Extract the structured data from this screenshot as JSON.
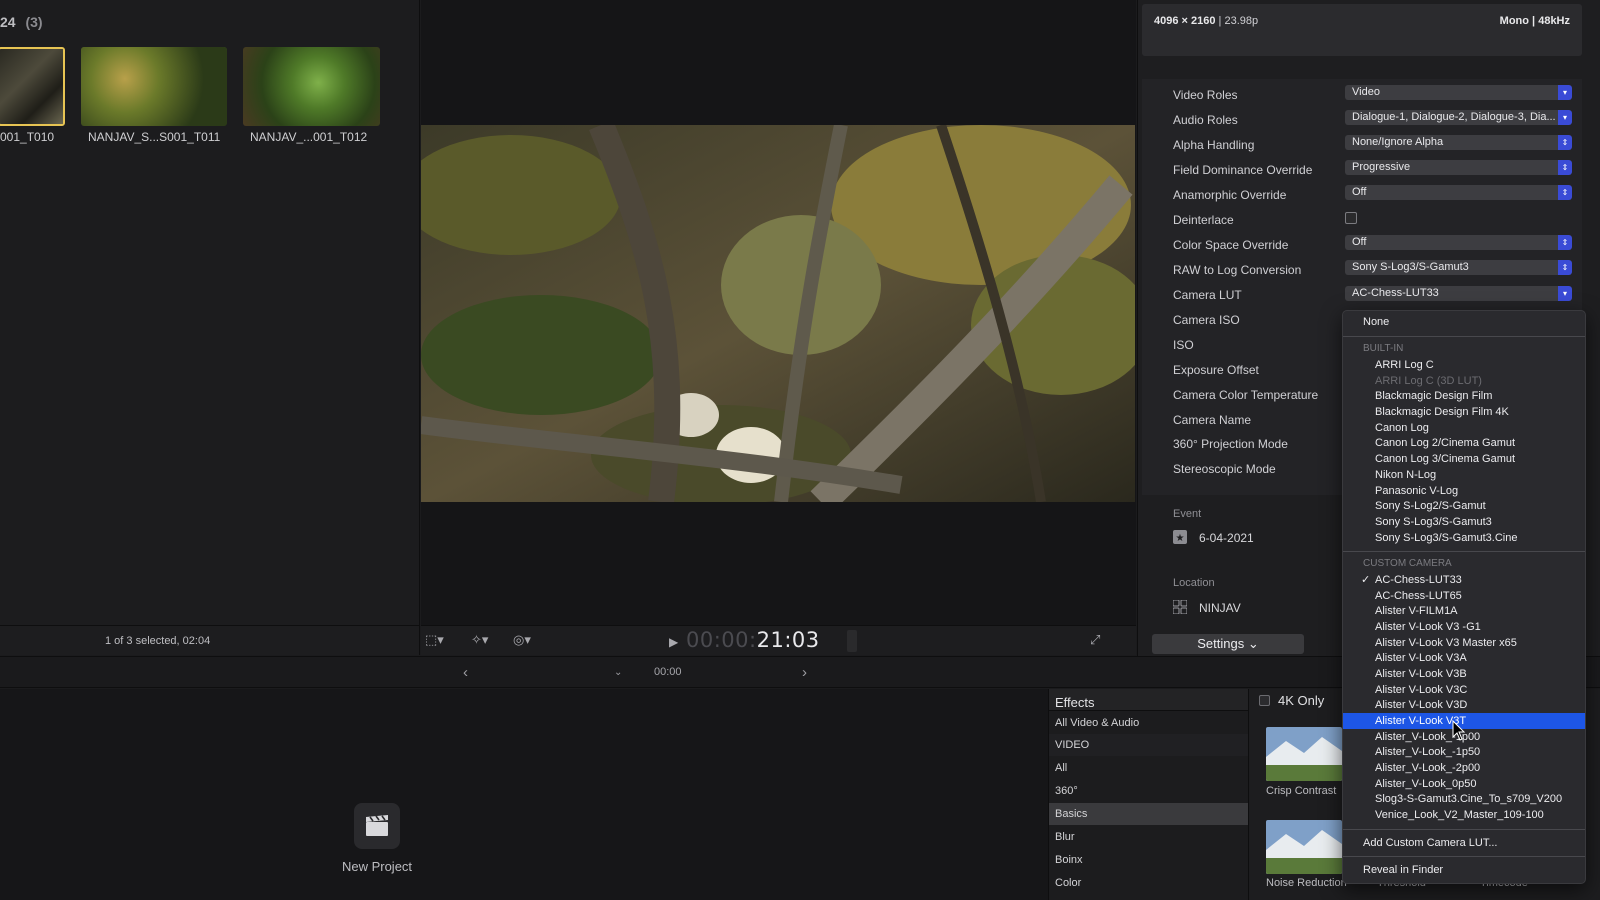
{
  "browser": {
    "header_num": "24",
    "header_count": "(3)",
    "clips": [
      {
        "label": "001_T010"
      },
      {
        "label": "NANJAV_S...S001_T011"
      },
      {
        "label": "NANJAV_...001_T012"
      }
    ],
    "status": "1 of 3 selected, 02:04"
  },
  "viewer": {
    "timecode_dim": "00:00:",
    "timecode_main": "21:03"
  },
  "timeline": {
    "time": "00:00"
  },
  "inspector": {
    "resolution": "4096 × 2160",
    "framerate": "23.98p",
    "audio_channels": "Mono",
    "audio_rate": "48kHz",
    "rows": [
      {
        "label": "Video Roles",
        "value": "Video"
      },
      {
        "label": "Audio Roles",
        "value": "Dialogue-1, Dialogue-2, Dialogue-3, Dia..."
      },
      {
        "label": "Alpha Handling",
        "value": "None/Ignore Alpha"
      },
      {
        "label": "Field Dominance Override",
        "value": "Progressive"
      },
      {
        "label": "Anamorphic Override",
        "value": "Off"
      },
      {
        "label": "Deinterlace",
        "value": ""
      },
      {
        "label": "Color Space Override",
        "value": "Off"
      },
      {
        "label": "RAW to Log Conversion",
        "value": "Sony S-Log3/S-Gamut3"
      },
      {
        "label": "Camera LUT",
        "value": "AC-Chess-LUT33"
      },
      {
        "label": "Camera ISO",
        "value": ""
      },
      {
        "label": "ISO",
        "value": ""
      },
      {
        "label": "Exposure Offset",
        "value": ""
      },
      {
        "label": "Camera Color Temperature",
        "value": ""
      },
      {
        "label": "Camera Name",
        "value": ""
      },
      {
        "label": "360° Projection Mode",
        "value": ""
      },
      {
        "label": "Stereoscopic Mode",
        "value": ""
      }
    ],
    "event_label": "Event",
    "event_value": "6-04-2021",
    "location_label": "Location",
    "location_value": "NINJAV",
    "settings_button": "Settings"
  },
  "lut_menu": {
    "none": "None",
    "builtin_header": "BUILT-IN",
    "builtin": [
      "ARRI Log C",
      "ARRI Log C (3D LUT)",
      "Blackmagic Design Film",
      "Blackmagic Design Film 4K",
      "Canon Log",
      "Canon Log 2/Cinema Gamut",
      "Canon Log 3/Cinema Gamut",
      "Nikon N-Log",
      "Panasonic V-Log",
      "Sony S-Log2/S-Gamut",
      "Sony S-Log3/S-Gamut3",
      "Sony S-Log3/S-Gamut3.Cine"
    ],
    "custom_header": "CUSTOM CAMERA",
    "custom": [
      "AC-Chess-LUT33",
      "AC-Chess-LUT65",
      "Alister V-FILM1A",
      "Alister V-Look V3 -G1",
      "Alister V-Look V3 Master x65",
      "Alister V-Look V3A",
      "Alister V-Look V3B",
      "Alister V-Look V3C",
      "Alister V-Look V3D",
      "Alister V-Look V3T",
      "Alister_V-Look_-1p00",
      "Alister_V-Look_-1p50",
      "Alister_V-Look_-2p00",
      "Alister_V-Look_0p50",
      "Slog3-S-Gamut3.Cine_To_s709_V200",
      "Venice_Look_V2_Master_109-100"
    ],
    "add": "Add Custom Camera LUT...",
    "reveal": "Reveal in Finder"
  },
  "effects": {
    "title": "Effects",
    "items": [
      "All Video & Audio",
      "VIDEO",
      "All",
      "360°",
      "Basics",
      "Blur",
      "Boinx",
      "Color"
    ],
    "only_4k": "4K Only",
    "thumbs": [
      "Crisp Contrast",
      "Noise Reduction",
      "Threshold",
      "Timecode"
    ]
  },
  "new_project": "New Project",
  "colors": {
    "accent": "#1d56e6",
    "selection": "#e7c453",
    "popup_arrow": "#3a4bd6"
  }
}
